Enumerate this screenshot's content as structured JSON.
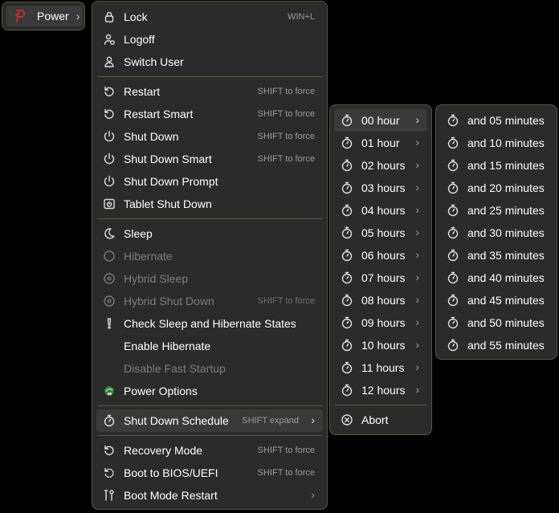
{
  "power_button": {
    "label": "Power",
    "icon": "power-plug-icon",
    "accent": "#c42b3a"
  },
  "main_menu": {
    "lock": {
      "label": "Lock",
      "hint": "WIN+L"
    },
    "logoff": {
      "label": "Logoff"
    },
    "switch_user": {
      "label": "Switch User"
    },
    "restart": {
      "label": "Restart",
      "hint": "SHIFT to force"
    },
    "restart_smart": {
      "label": "Restart Smart",
      "hint": "SHIFT to force"
    },
    "shut_down": {
      "label": "Shut Down",
      "hint": "SHIFT to force"
    },
    "shut_down_smart": {
      "label": "Shut Down Smart",
      "hint": "SHIFT to force"
    },
    "shut_down_prompt": {
      "label": "Shut Down Prompt"
    },
    "tablet_shut_down": {
      "label": "Tablet Shut Down"
    },
    "sleep": {
      "label": "Sleep"
    },
    "hibernate": {
      "label": "Hibernate",
      "disabled": true
    },
    "hybrid_sleep": {
      "label": "Hybrid Sleep",
      "disabled": true
    },
    "hybrid_shut_down": {
      "label": "Hybrid Shut Down",
      "hint": "SHIFT to force",
      "disabled": true
    },
    "check_states": {
      "label": "Check Sleep and Hibernate States"
    },
    "enable_hibernate": {
      "label": "Enable Hibernate"
    },
    "disable_fast_startup": {
      "label": "Disable Fast Startup",
      "disabled": true
    },
    "power_options": {
      "label": "Power Options"
    },
    "shut_down_schedule": {
      "label": "Shut Down Schedule",
      "hint": "SHIFT expand"
    },
    "recovery_mode": {
      "label": "Recovery Mode",
      "hint": "SHIFT to force"
    },
    "boot_bios": {
      "label": "Boot to BIOS/UEFI",
      "hint": "SHIFT to force"
    },
    "boot_mode_restart": {
      "label": "Boot Mode Restart"
    }
  },
  "hours_menu": {
    "items": [
      "00 hour",
      "01 hour",
      "02 hours",
      "03 hours",
      "04 hours",
      "05 hours",
      "06 hours",
      "07 hours",
      "08 hours",
      "09 hours",
      "10 hours",
      "11 hours",
      "12 hours"
    ],
    "abort": "Abort"
  },
  "minutes_menu": {
    "items": [
      "and 05 minutes",
      "and 10 minutes",
      "and 15 minutes",
      "and 20 minutes",
      "and 25 minutes",
      "and 30 minutes",
      "and 35 minutes",
      "and 40 minutes",
      "and 45 minutes",
      "and 50 minutes",
      "and 55 minutes"
    ]
  },
  "colors": {
    "panel": "#2b2b2b",
    "border": "#57573a",
    "highlight": "#3a3a3a",
    "disabled_text": "#7d7d7d"
  }
}
